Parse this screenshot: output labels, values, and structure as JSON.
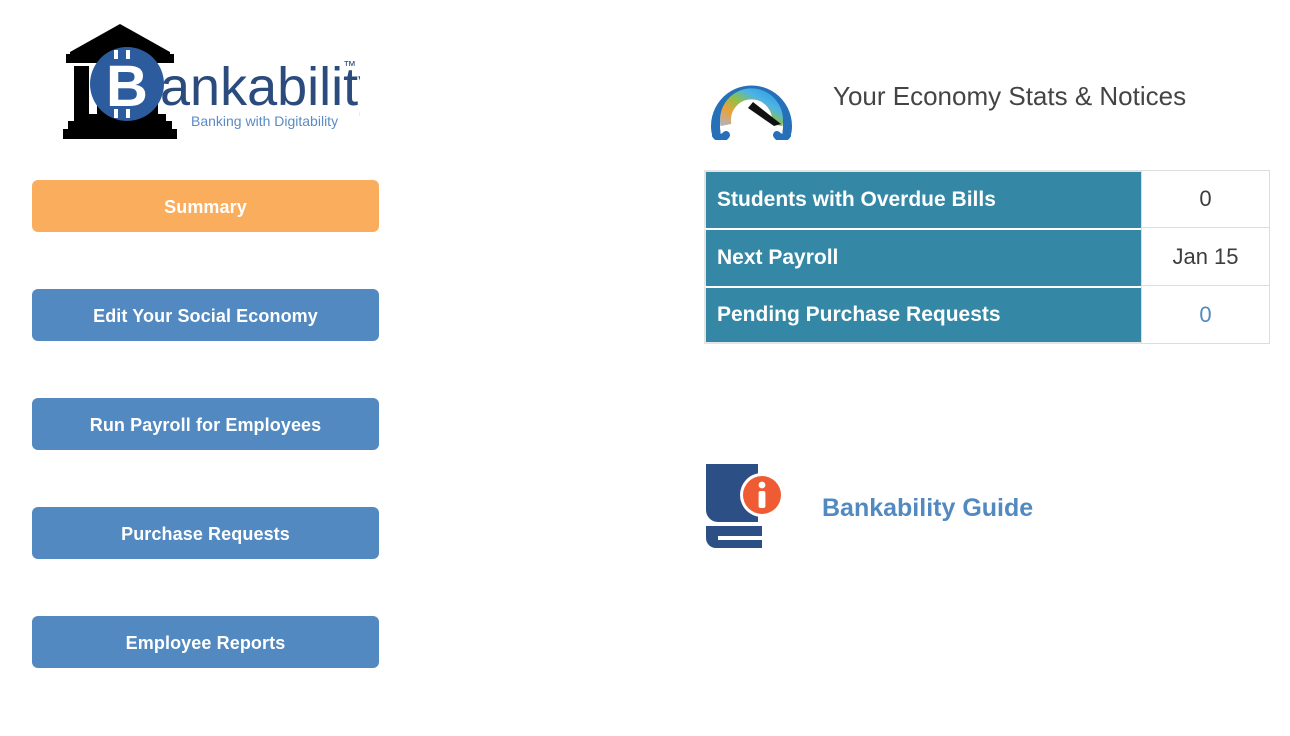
{
  "logo": {
    "name": "Bankability",
    "wordmark_prefix": "B",
    "wordmark_rest": "ankability",
    "trademark": "™",
    "tagline": "Banking with Digitability",
    "building_color": "#000000",
    "circle_color": "#2c5c9e",
    "wordmark_color": "#2a4b7c",
    "tagline_color": "#5b8bc4"
  },
  "nav": {
    "buttons": [
      {
        "label": "Summary",
        "state": "active",
        "color": "#f9ad5d"
      },
      {
        "label": "Edit Your Social Economy",
        "state": "normal",
        "color": "#5189c0"
      },
      {
        "label": "Run Payroll for Employees",
        "state": "normal",
        "color": "#5189c0"
      },
      {
        "label": "Purchase Requests",
        "state": "normal",
        "color": "#5189c0"
      },
      {
        "label": "Employee Reports",
        "state": "normal",
        "color": "#5189c0"
      }
    ]
  },
  "stats": {
    "icon": "gauge-icon",
    "title": "Your Economy Stats & Notices",
    "title_color": "#444444",
    "row_label_color": "#3488a6",
    "rows": [
      {
        "label": "Students with Overdue Bills",
        "value": "0",
        "is_link": false
      },
      {
        "label": "Next Payroll",
        "value": "Jan 15",
        "is_link": false
      },
      {
        "label": "Pending Purchase Requests",
        "value": "0",
        "is_link": true
      }
    ]
  },
  "guide": {
    "icon": "book-info-icon",
    "label": "Bankability Guide",
    "label_color": "#5189c0",
    "book_color": "#2c4f86",
    "badge_color": "#ef5b33",
    "badge_glyph": "i"
  }
}
